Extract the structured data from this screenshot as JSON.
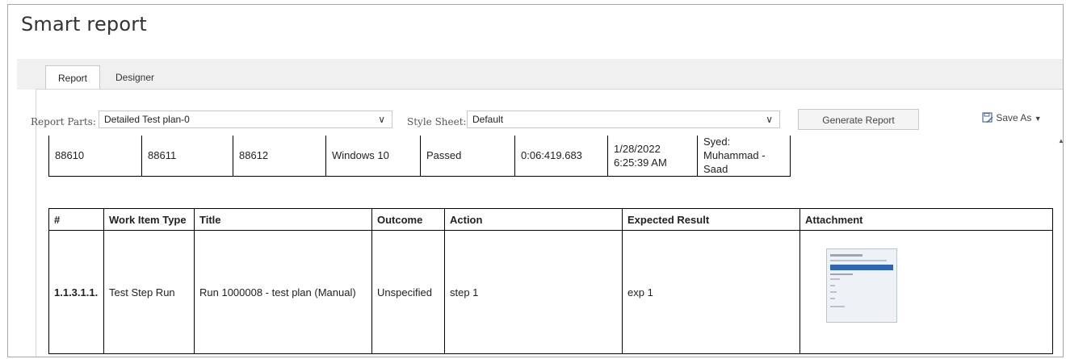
{
  "app_title": "Smart report",
  "tabs": [
    {
      "label": "Report"
    },
    {
      "label": "Designer"
    }
  ],
  "toolbar": {
    "report_parts_label": "Report Parts:",
    "report_parts_value": "Detailed Test plan-0",
    "style_sheet_label": "Style Sheet:",
    "style_sheet_value": "Default",
    "generate_label": "Generate Report",
    "save_as_label": "Save As"
  },
  "run_row": [
    "88610",
    "88611",
    "88612",
    "Windows 10",
    "Passed",
    "0:06:419.683",
    "1/28/2022\n6:25:39 AM",
    "Syed:\nMuhammad -\nSaad"
  ],
  "steps_table": {
    "headers": [
      "#",
      "Work Item Type",
      "Title",
      "Outcome",
      "Action",
      "Expected Result",
      "Attachment"
    ],
    "row": [
      "1.1.3.1.1.",
      "Test Step Run",
      "Run 1000008 - test plan (Manual)",
      "Unspecified",
      "step 1",
      "exp 1",
      ""
    ]
  },
  "icons": {
    "dropdown": "chevron-down-icon",
    "save": "save-as-icon",
    "caret": "caret-down-icon",
    "scroll_up": "scroll-up-arrow-icon"
  }
}
